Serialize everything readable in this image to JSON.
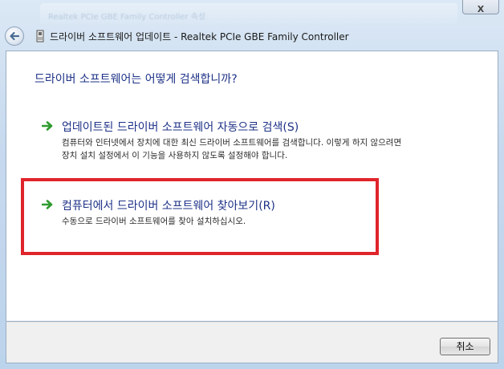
{
  "window": {
    "title": "드라이버 소프트웨어 업데이트 - Realtek PCIe GBE Family Controller",
    "background_title": "Realtek PCIe GBE Family Controller 속성"
  },
  "controls": {
    "close_symbol": "X",
    "back_icon": "back-arrow-icon",
    "app_icon": "network-card-icon"
  },
  "main": {
    "heading": "드라이버 소프트웨어는 어떻게 검색합니까?",
    "options": [
      {
        "title": "업데이트된 드라이버 소프트웨어 자동으로 검색(S)",
        "description": "컴퓨터와 인터넷에서 장치에 대한 최신 드라이버 소프트웨어를 검색합니다. 이렇게 하지 않으려면 장치 설치 설정에서 이 기능을 사용하지 않도록 설정해야 합니다."
      },
      {
        "title": "컴퓨터에서 드라이버 소프트웨어 찾아보기(R)",
        "description": "수동으로 드라이버 소프트웨어를 찾아 설치하십시오."
      }
    ]
  },
  "footer": {
    "cancel_label": "취소"
  },
  "colors": {
    "heading": "#1e3287",
    "arrow": "#2e9b2e",
    "highlight": "#e0242b"
  }
}
